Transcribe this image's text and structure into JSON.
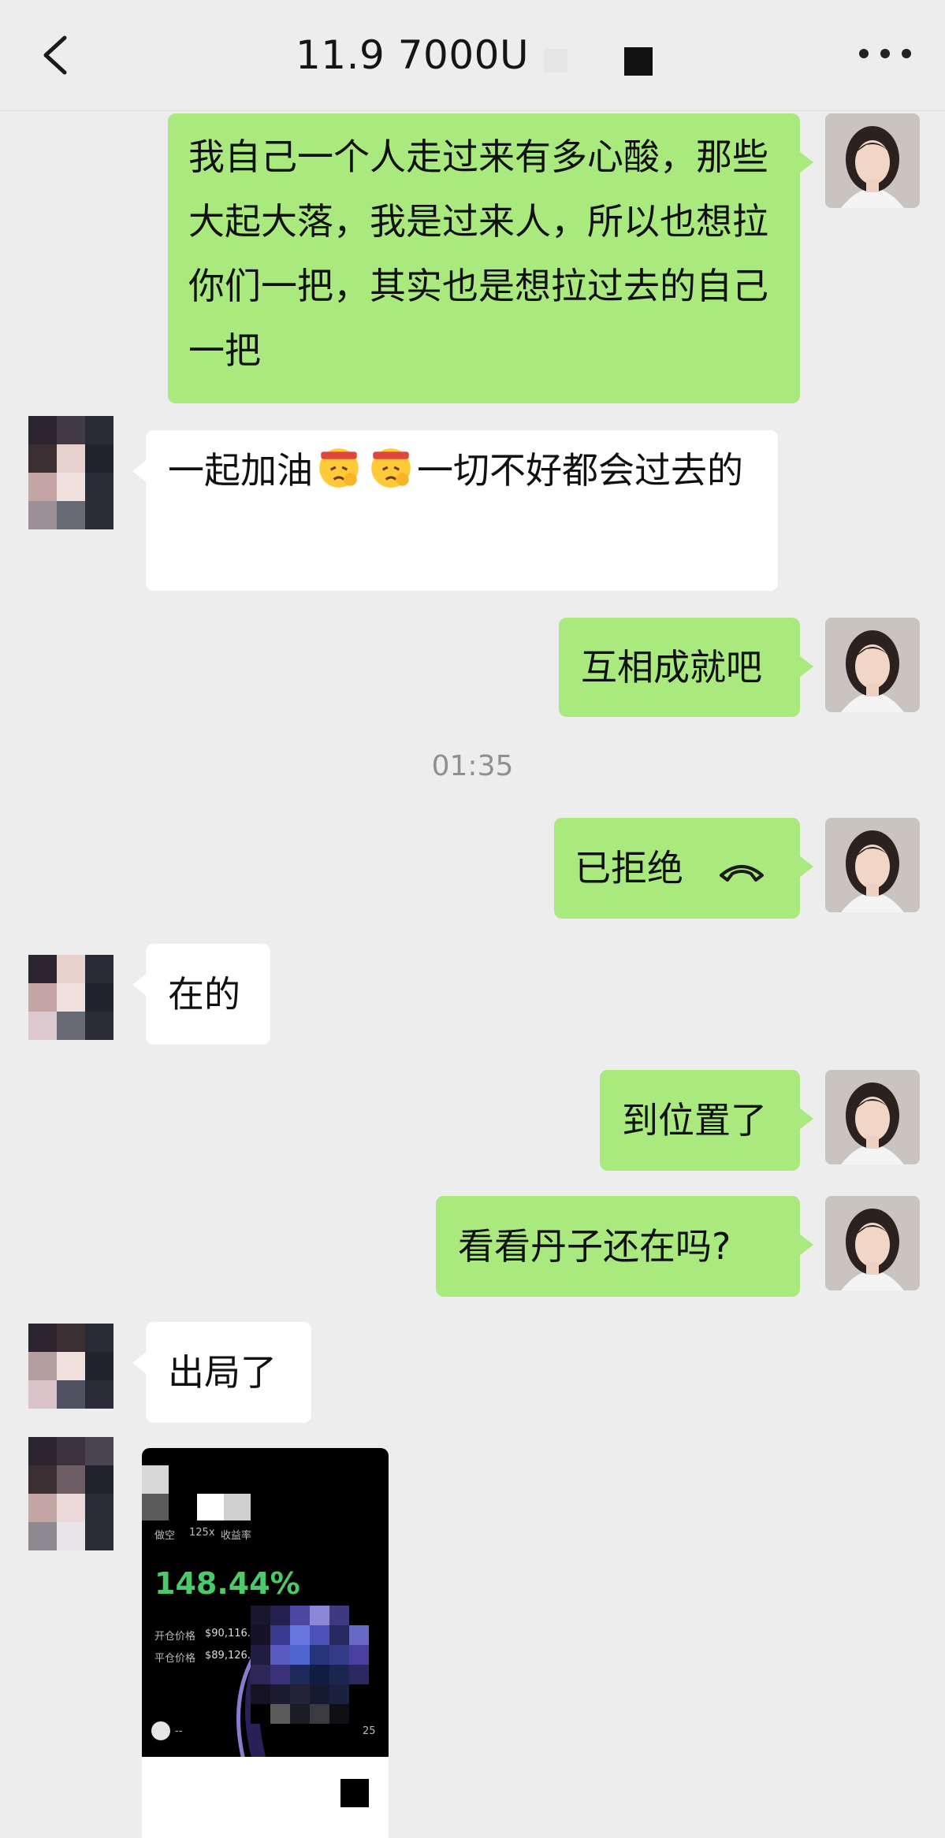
{
  "header": {
    "title": "11.9  7000U",
    "back_icon": "chevron-left-icon",
    "more_icon": "more-dots-icon"
  },
  "messages": [
    {
      "side": "me",
      "text": "我自己一个人走过来有多心酸，那些大起大落，我是过来人，所以也想拉你们一把，其实也是想拉过去的自己一把"
    },
    {
      "side": "them",
      "text_before": "一起加油",
      "emojis": [
        "determined-face-emoji",
        "determined-face-emoji"
      ],
      "text_after": "一切不好都会过去的"
    },
    {
      "side": "me",
      "text": "互相成就吧"
    },
    {
      "type": "timestamp",
      "text": "01:35"
    },
    {
      "side": "me",
      "text": "已拒绝",
      "icon": "declined-call-icon"
    },
    {
      "side": "them",
      "text": "在的"
    },
    {
      "side": "me",
      "text": "到位置了"
    },
    {
      "side": "me",
      "text": "看看丹子还在吗?"
    },
    {
      "side": "them",
      "text": "出局了"
    }
  ],
  "shared_image": {
    "labels": [
      "做空",
      "125x",
      "收益率"
    ],
    "return_pct": "148.44%",
    "open_label": "开仓价格",
    "open_price": "$90,116.2",
    "close_label": "平仓价格",
    "close_price": "$89,126.3",
    "footer_text": "--",
    "footer_number": "25"
  },
  "colors": {
    "background": "#ededed",
    "my_bubble": "#a9e97e",
    "their_bubble": "#ffffff",
    "return_green": "#4cc96a"
  }
}
